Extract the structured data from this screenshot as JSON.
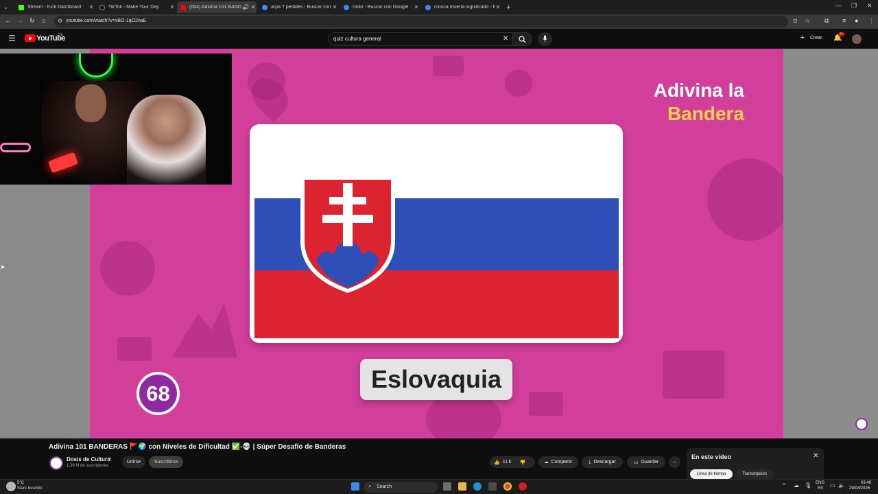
{
  "browser": {
    "tabs": [
      {
        "label": "Stream - Kick Dashboard",
        "color": "#53fc18",
        "active": false
      },
      {
        "label": "TikTok - Make Your Day",
        "color": "#111111",
        "active": false
      },
      {
        "label": "(604) Adivina 101 BANDERAS",
        "color": "#ff0000",
        "active": true
      },
      {
        "label": "arpa 7 pedales - Buscar con G",
        "color": "#4285f4",
        "active": false
      },
      {
        "label": "rodio - Buscar con Google",
        "color": "#4285f4",
        "active": false
      },
      {
        "label": "mosca muerta significado - Bus",
        "color": "#4285f4",
        "active": false
      }
    ],
    "url": "youtube.com/watch?v=vBO-1qO2naE"
  },
  "youtube": {
    "logo_text": "YouTube",
    "logo_sup": "SE",
    "search_value": "quiz cultura general",
    "create_label": "Crear",
    "notif_badge": "9+"
  },
  "video": {
    "title_line1": "Adivina la",
    "title_line2": "Bandera",
    "answer": "Eslovaquia",
    "counter": "68"
  },
  "meta": {
    "title": "Adivina 101 BANDERAS 🚩🌍 con Niveles de Dificultad ✅-💀 | Súper Desafío de Banderas",
    "channel": "Dosis de Cultura",
    "subscribers": "1,36 M de suscriptores",
    "join_label": "Unirse",
    "subscribe_label": "Suscribirse",
    "likes": "11 k",
    "share_label": "Compartir",
    "download_label": "Descargar",
    "save_label": "Guardar"
  },
  "panel": {
    "title": "En este video",
    "tab1": "Línea de tiempo",
    "tab2": "Transcripción"
  },
  "taskbar": {
    "weather_temp": "5°C",
    "weather_desc": "Stark bewölkt",
    "search_label": "Search",
    "lang1": "ENG",
    "lang2": "ES",
    "time": "03:49",
    "date": "29/03/2026"
  },
  "colors": {
    "video_bg": "#d23f9b",
    "title_white": "#ffffff",
    "title_yellow": "#f2d04a",
    "flag_white": "#ffffff",
    "flag_blue": "#2e4fb8",
    "flag_red": "#dc2430",
    "counter_purple": "#8e2aa0"
  }
}
